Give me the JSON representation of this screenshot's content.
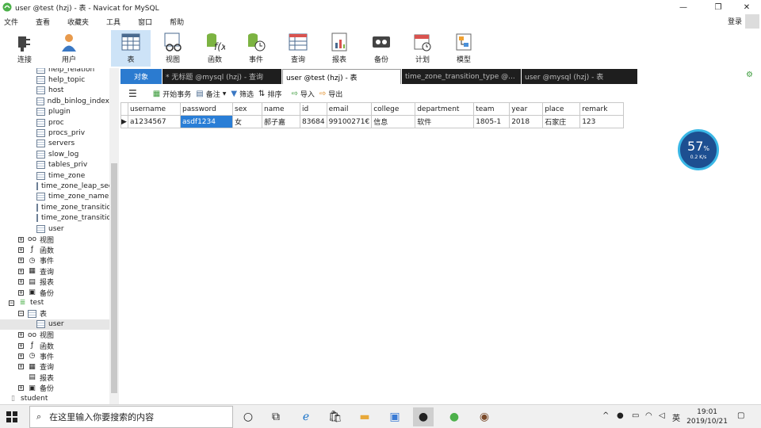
{
  "window": {
    "title": "user @test (hzj) - 表 - Navicat for MySQL",
    "minimize_glyph": "—",
    "restore_glyph": "❐",
    "close_glyph": "✕"
  },
  "menu": [
    "文件",
    "查看",
    "收藏夹",
    "工具",
    "窗口",
    "帮助"
  ],
  "login_label": "登录",
  "toolbar": {
    "connect": "连接",
    "user": "用户",
    "table": "表",
    "view": "视图",
    "function": "函数",
    "event": "事件",
    "query": "查询",
    "report": "报表",
    "backup": "备份",
    "schedule": "计划",
    "model": "模型"
  },
  "sidebar": {
    "tables": [
      "help_relation",
      "help_topic",
      "host",
      "ndb_binlog_index",
      "plugin",
      "proc",
      "procs_priv",
      "servers",
      "slow_log",
      "tables_priv",
      "time_zone",
      "time_zone_leap_sec",
      "time_zone_name",
      "time_zone_transition",
      "time_zone_transition_type",
      "user"
    ],
    "mysql_groups": [
      "视图",
      "函数",
      "事件",
      "查询",
      "报表",
      "备份"
    ],
    "db_test": "test",
    "test_table_group": "表",
    "test_table_user": "user",
    "test_groups_a": [
      "视图",
      "函数",
      "事件",
      "查询"
    ],
    "test_report": "报表",
    "test_backup": "备份",
    "db_student": "student"
  },
  "tabs": {
    "objects": "对象",
    "t1": "* 无标题 @mysql (hzj) - 查询",
    "t2": "user @test (hzj) - 表",
    "t3": "time_zone_transition_type @...",
    "t4": "user @mysql (hzj) - 表"
  },
  "subtoolbar": {
    "begin_tx": "开始事务",
    "memo": "备注",
    "filter": "筛选",
    "sort": "排序",
    "import": "导入",
    "export": "导出"
  },
  "grid": {
    "columns": [
      "username",
      "password",
      "sex",
      "name",
      "id",
      "email",
      "college",
      "department",
      "team",
      "year",
      "place",
      "remark"
    ],
    "rows": [
      [
        "a1234567",
        "asdf1234",
        "女",
        "郝子嘉",
        "83684",
        "99100271€",
        "信息",
        "软件",
        "1805-1",
        "2018",
        "石家庄",
        "123"
      ]
    ]
  },
  "net_widget": {
    "percent": "57",
    "unit": "%",
    "speed": "0.2 K/s"
  },
  "taskbar": {
    "search_placeholder": "在这里输入你要搜索的内容",
    "ime": "英",
    "time": "19:01",
    "date": "2019/10/21"
  },
  "colors": {
    "accent": "#2b7bd0",
    "selection": "#2a7ed6",
    "tab_dark": "#1e1e1e",
    "toolbar_active": "#cde3f7"
  }
}
